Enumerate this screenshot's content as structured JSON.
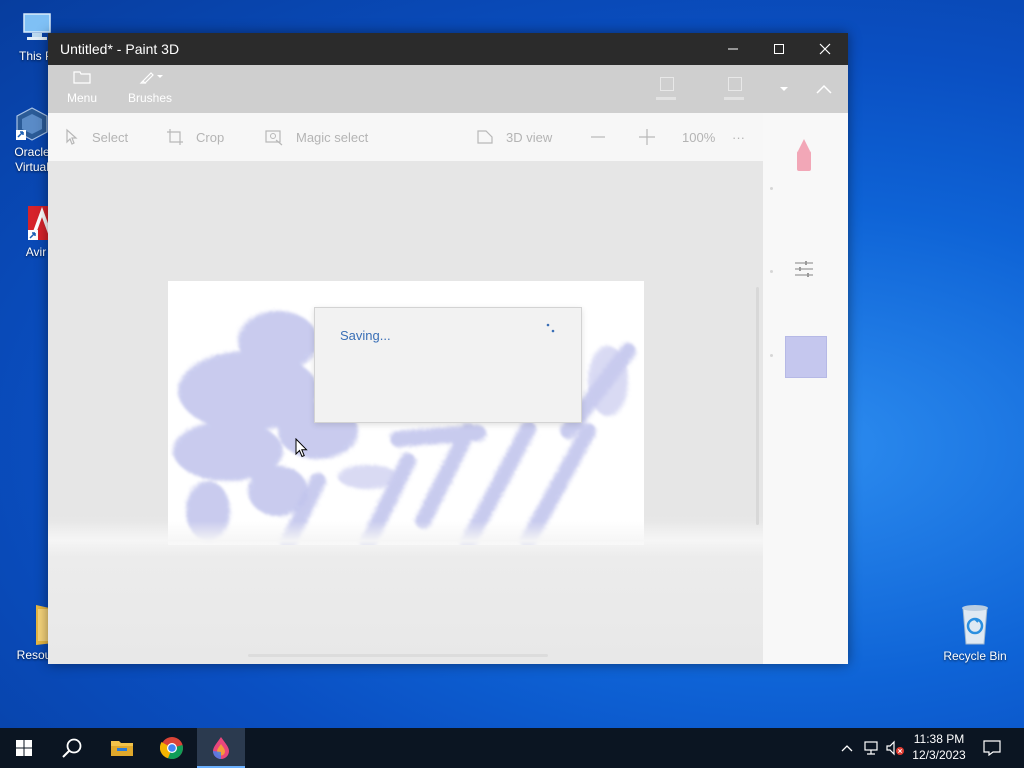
{
  "desktop": {
    "icons": [
      {
        "label": "This P"
      },
      {
        "label": "Oracle Virtual"
      },
      {
        "label": "Avir"
      },
      {
        "label": "Resour"
      },
      {
        "label": "Recycle Bin"
      }
    ]
  },
  "window": {
    "title": "Untitled* - Paint 3D",
    "ribbon": {
      "menu_label": "Menu",
      "brushes_label": "Brushes"
    },
    "toolbar": {
      "select_label": "Select",
      "crop_label": "Crop",
      "magic_select_label": "Magic select",
      "view3d_label": "3D view",
      "zoom_value": "100%",
      "more_label": "···"
    },
    "dialog": {
      "message": "Saving..."
    },
    "colors": {
      "selected_color": "#c5c7ee",
      "tool_color": "#f2a7b7"
    }
  },
  "taskbar": {
    "apps": [
      "Start",
      "Search",
      "File Explorer",
      "Google Chrome",
      "Paint 3D"
    ],
    "clock_time": "11:38 PM",
    "clock_date": "12/3/2023"
  }
}
